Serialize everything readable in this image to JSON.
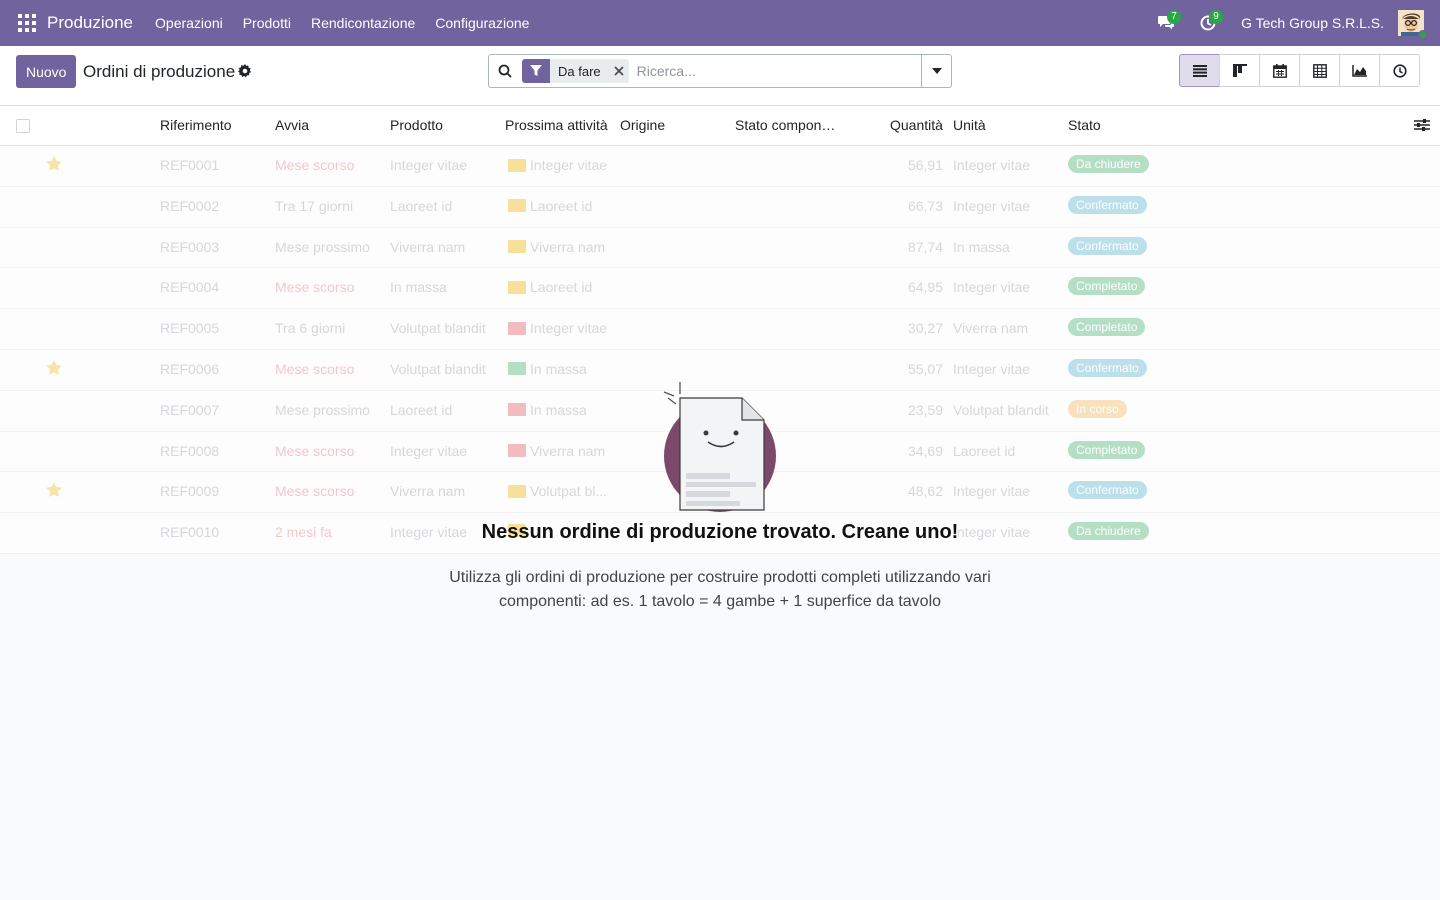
{
  "navbar": {
    "brand": "Produzione",
    "menu": [
      "Operazioni",
      "Prodotti",
      "Rendicontazione",
      "Configurazione"
    ],
    "messages_count": "7",
    "activities_count": "9",
    "company": "G Tech Group S.R.L.S."
  },
  "control": {
    "new_label": "Nuovo",
    "title": "Ordini di produzione",
    "facet_label": "Da fare",
    "search_placeholder": "Ricerca..."
  },
  "columns": [
    "Riferimento",
    "Avvia",
    "Prodotto",
    "Prossima attività",
    "Origine",
    "Stato compon…",
    "Quantità",
    "Unità",
    "Stato"
  ],
  "rows": [
    {
      "star": true,
      "ref": "REF0001",
      "start": "Mese scorso",
      "late": true,
      "product": "Integer vitae",
      "activity": "Integer vitae",
      "act_color": "#f6d87a",
      "qty": "56,91",
      "unit": "Integer vitae",
      "state": "Da chiudere",
      "state_color": "#9fd6b4"
    },
    {
      "star": false,
      "ref": "REF0002",
      "start": "Tra 17 giorni",
      "late": false,
      "product": "Laoreet id",
      "activity": "Laoreet id",
      "act_color": "#f6d87a",
      "qty": "66,73",
      "unit": "Integer vitae",
      "state": "Confermato",
      "state_color": "#a7d8e6"
    },
    {
      "star": false,
      "ref": "REF0003",
      "start": "Mese prossimo",
      "late": false,
      "product": "Viverra nam",
      "activity": "Viverra nam",
      "act_color": "#f6d87a",
      "qty": "87,74",
      "unit": "In massa",
      "state": "Confermato",
      "state_color": "#a7d8e6"
    },
    {
      "star": false,
      "ref": "REF0004",
      "start": "Mese scorso",
      "late": true,
      "product": "In massa",
      "activity": "Laoreet id",
      "act_color": "#f6d87a",
      "qty": "64,95",
      "unit": "Integer vitae",
      "state": "Completato",
      "state_color": "#9fd6b4"
    },
    {
      "star": false,
      "ref": "REF0005",
      "start": "Tra 6 giorni",
      "late": false,
      "product": "Volutpat blandit",
      "activity": "Integer vitae",
      "act_color": "#f2a7ab",
      "qty": "30,27",
      "unit": "Viverra nam",
      "state": "Completato",
      "state_color": "#9fd6b4"
    },
    {
      "star": true,
      "ref": "REF0006",
      "start": "Mese scorso",
      "late": true,
      "product": "Volutpat blandit",
      "activity": "In massa",
      "act_color": "#9fd6b4",
      "qty": "55,07",
      "unit": "Integer vitae",
      "state": "Confermato",
      "state_color": "#a7d8e6"
    },
    {
      "star": false,
      "ref": "REF0007",
      "start": "Mese prossimo",
      "late": false,
      "product": "Laoreet id",
      "activity": "In massa",
      "act_color": "#f2a7ab",
      "qty": "23,59",
      "unit": "Volutpat blandit",
      "state": "In corso",
      "state_color": "#f8d9a8"
    },
    {
      "star": false,
      "ref": "REF0008",
      "start": "Mese scorso",
      "late": true,
      "product": "Integer vitae",
      "activity": "Viverra nam",
      "act_color": "#f2a7ab",
      "qty": "34,69",
      "unit": "Laoreet id",
      "state": "Completato",
      "state_color": "#9fd6b4"
    },
    {
      "star": true,
      "ref": "REF0009",
      "start": "Mese scorso",
      "late": true,
      "product": "Viverra nam",
      "activity": "Volutpat bl...",
      "act_color": "#f6d87a",
      "qty": "48,62",
      "unit": "Integer vitae",
      "state": "Confermato",
      "state_color": "#a7d8e6"
    },
    {
      "star": false,
      "ref": "REF0010",
      "start": "2 mesi fa",
      "late": true,
      "product": "Integer vitae",
      "activity": "",
      "act_color": "#f6d87a",
      "qty": "",
      "unit": "Integer vitae",
      "state": "Da chiudere",
      "state_color": "#9fd6b4"
    }
  ],
  "empty": {
    "title": "Nessun ordine di produzione trovato. Creane uno!",
    "text": "Utilizza gli ordini di produzione per costruire prodotti completi utilizzando vari componenti: ad es. 1 tavolo = 4 gambe + 1 superfice da tavolo"
  },
  "colors": {
    "brand": "#71639e",
    "badge": "#28a745"
  }
}
